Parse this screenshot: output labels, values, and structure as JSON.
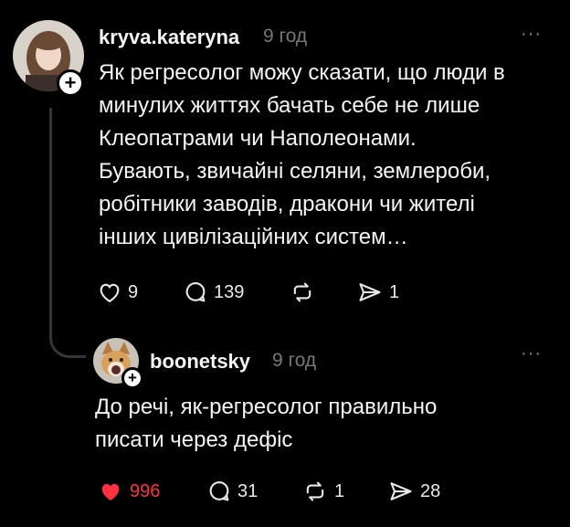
{
  "post1": {
    "username": "kryva.kateryna",
    "time": "9 год",
    "more": "···",
    "text": "Як регресолог можу сказати, що люди в\nминулих життях бачать себе не лише\nКлеопатрами чи Наполеонами.\nБувають, звичайні селяни, землероби,\nробітники заводів, дракони чи жителі\nінших цивілізаційних систем…",
    "likes": "9",
    "comments": "139",
    "reposts": "",
    "shares": "1",
    "follow": "+"
  },
  "post2": {
    "username": "boonetsky",
    "time": "9 год",
    "more": "···",
    "text": "До речі, як-регресолог правильно\nписати через дефіс",
    "likes": "996",
    "comments": "31",
    "reposts": "1",
    "shares": "28",
    "follow": "+"
  },
  "icons": {
    "like": "heart-icon",
    "comment": "comment-icon",
    "repost": "repost-icon",
    "share": "send-icon"
  },
  "colors": {
    "liked": "#ff3040",
    "background": "#000000"
  }
}
